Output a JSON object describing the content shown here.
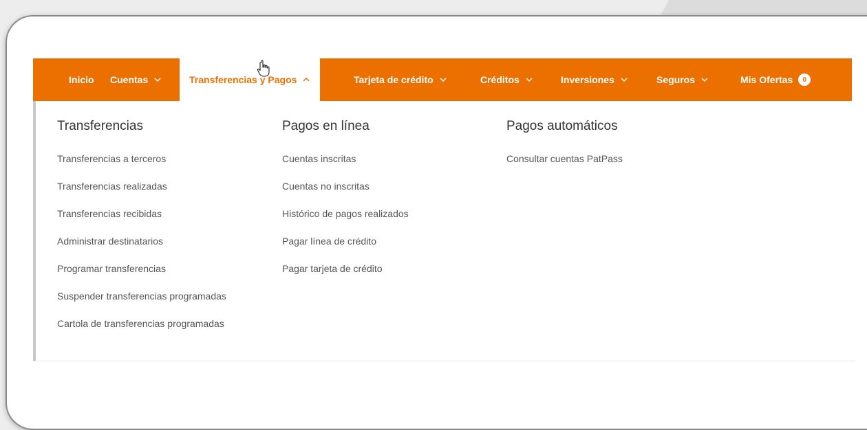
{
  "nav": {
    "items": [
      {
        "label": "Inicio",
        "has_chevron": false
      },
      {
        "label": "Cuentas",
        "has_chevron": true
      },
      {
        "label": "Transferencias y Pagos",
        "has_chevron": true,
        "active": true
      },
      {
        "label": "Tarjeta de crédito",
        "has_chevron": true
      },
      {
        "label": "Créditos",
        "has_chevron": true
      },
      {
        "label": "Inversiones",
        "has_chevron": true
      },
      {
        "label": "Seguros",
        "has_chevron": true
      },
      {
        "label": "Mis Ofertas",
        "badge": "0"
      }
    ]
  },
  "menu": {
    "columns": [
      {
        "title": "Transferencias",
        "links": [
          "Transferencias a terceros",
          "Transferencias realizadas",
          "Transferencias recibidas",
          "Administrar destinatarios",
          "Programar transferencias",
          "Suspender transferencias programadas",
          "Cartola de transferencias programadas"
        ]
      },
      {
        "title": "Pagos en línea",
        "links": [
          "Cuentas inscritas",
          "Cuentas no inscritas",
          "Histórico de pagos realizados",
          "Pagar línea de crédito",
          "Pagar tarjeta de crédito"
        ]
      },
      {
        "title": "Pagos automáticos",
        "links": [
          "Consultar cuentas PatPass"
        ]
      }
    ]
  },
  "colors": {
    "brand": "#ec7000",
    "nav_text": "#ffffff",
    "link_text": "#555555"
  }
}
